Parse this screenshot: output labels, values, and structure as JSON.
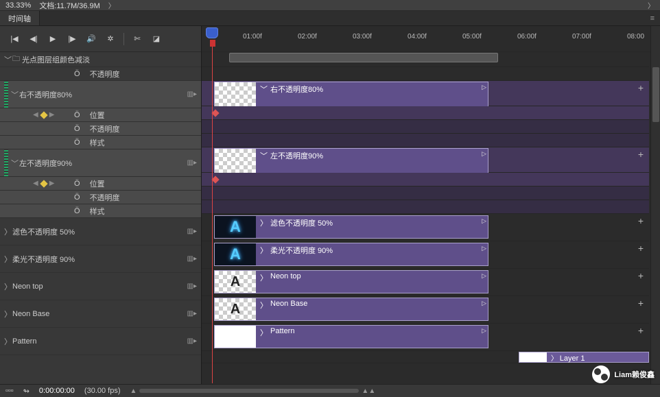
{
  "topbar": {
    "zoom": "33.33%",
    "doc": "文档:11.7M/36.9M"
  },
  "tab": {
    "label": "时间轴"
  },
  "toolbar": {
    "go_start": "|◀",
    "prev": "◀|",
    "play": "▶",
    "next": "|▶",
    "audio": "🔊",
    "settings": "⚙",
    "split": "✂",
    "contrast": "◪"
  },
  "ruler": {
    "ticks": [
      "01:00f",
      "02:00f",
      "03:00f",
      "04:00f",
      "05:00f",
      "06:00f",
      "07:00f",
      "08:00"
    ]
  },
  "layers": {
    "group": "光点图层组颜色减淡",
    "group_opacity": "不透明度",
    "right80": "右不透明度80%",
    "left90": "左不透明度90%",
    "filter50": "滤色不透明度 50%",
    "soft90": "柔光不透明度 90%",
    "neontop": "Neon top",
    "neonbase": "Neon Base",
    "pattern": "Pattern",
    "layer1": "Layer 1"
  },
  "props": {
    "position": "位置",
    "opacity": "不透明度",
    "style": "样式"
  },
  "footer": {
    "timecode": "0:00:00:00",
    "fps": "(30.00 fps)"
  },
  "icons": {
    "stopwatch": "Ö",
    "film": "▥",
    "chev_r": "〉",
    "chev_d": "﹀",
    "plus": "+"
  },
  "watermark": "Liam赖俊鑫"
}
